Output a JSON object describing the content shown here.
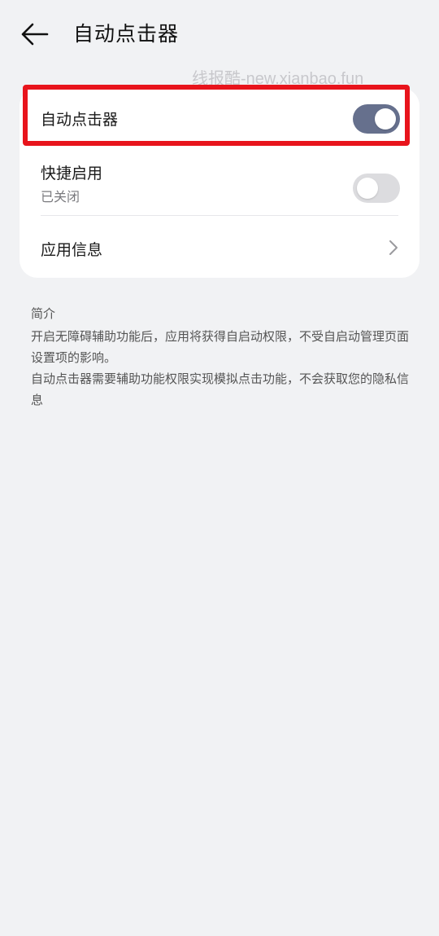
{
  "header": {
    "back_icon": "arrow-left-icon",
    "title": "自动点击器"
  },
  "watermark": "线报酷-new.xianbao.fun",
  "settings": {
    "auto_clicker": {
      "label": "自动点击器",
      "state": "on"
    },
    "quick_start": {
      "label": "快捷启用",
      "status": "已关闭",
      "state": "off"
    },
    "app_info": {
      "label": "应用信息",
      "icon": "chevron-right-icon"
    }
  },
  "intro": {
    "heading": "简介",
    "para1": "开启无障碍辅助功能后，应用将获得自启动权限，不受自启动管理页面设置项的影响。",
    "para2": "自动点击器需要辅助功能权限实现模拟点击功能，不会获取您的隐私信息"
  },
  "colors": {
    "background": "#f1f2f4",
    "toggle_on": "#66708d",
    "toggle_off": "#dcdcdf",
    "highlight": "#e8141c"
  }
}
